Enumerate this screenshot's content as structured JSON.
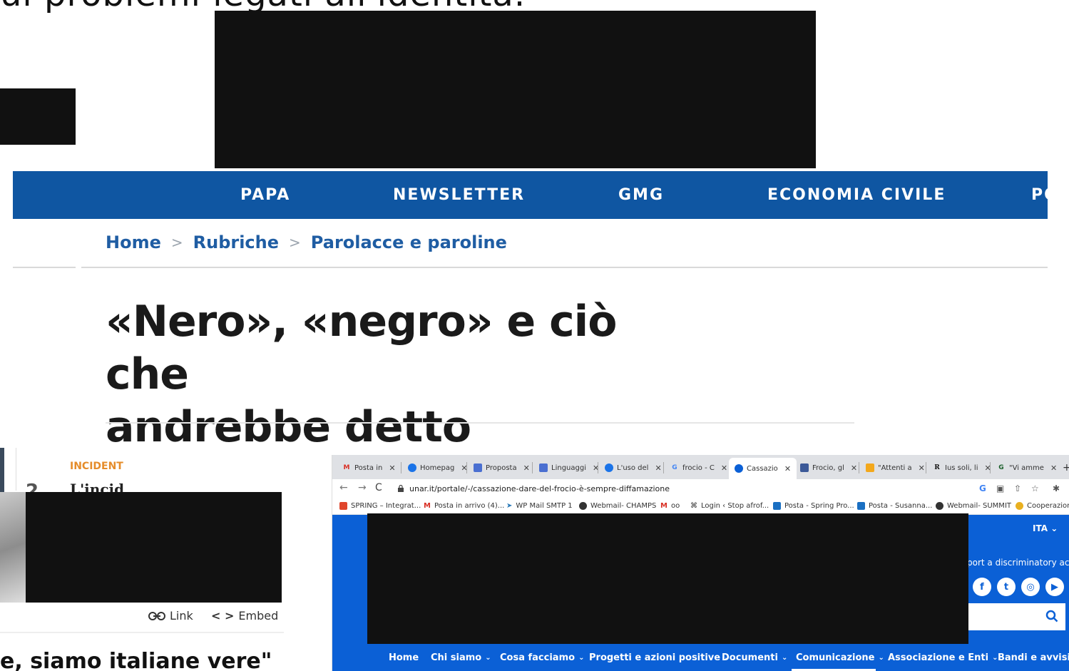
{
  "top_heading": "ui problemi legati all'identità.",
  "avvenire": {
    "nav": [
      "PAPA",
      "NEWSLETTER",
      "GMG",
      "ECONOMIA CIVILE",
      "PO"
    ],
    "breadcrumb": [
      "Home",
      "Rubriche",
      "Parolacce e paroline"
    ],
    "breadcrumb_sep": ">",
    "title_line1": "«Nero», «negro» e ciò che",
    "title_line2": "andrebbe detto",
    "accent": "#0f56a2"
  },
  "left_fragment": {
    "category": "INCIDENT",
    "headline_start": "L'incid",
    "number": "2",
    "link_label": "Link",
    "embed_label": "Embed",
    "quote": "e, siamo italiane vere\""
  },
  "browser": {
    "tabs": [
      {
        "icon": "gmail-icon",
        "label": "Posta in"
      },
      {
        "icon": "homepage-icon",
        "label": "Homepag"
      },
      {
        "icon": "proposta-icon",
        "label": "Proposta"
      },
      {
        "icon": "linguaggio-icon",
        "label": "Linguaggi"
      },
      {
        "icon": "uso-icon",
        "label": "L'uso del"
      },
      {
        "icon": "google-icon",
        "label": "frocio - C"
      },
      {
        "icon": "cassazione-icon",
        "label": "Cassazio"
      },
      {
        "icon": "frocio-icon",
        "label": "Frocio, gl"
      },
      {
        "icon": "attenti-icon",
        "label": "\"Attenti a"
      },
      {
        "icon": "r-icon",
        "label": "Ius soli, li"
      },
      {
        "icon": "g-icon",
        "label": "\"Vi amme"
      }
    ],
    "new_tab": "+",
    "url": "unar.it/portale/-/cassazione-dare-del-frocio-è-sempre-diffamazione",
    "bookmarks": [
      "SPRING – Integrat...",
      "Posta in arrivo (4)...",
      "WP Mail SMTP 1",
      "Webmail- CHAMPS",
      "oo",
      "Login ‹ Stop afrof...",
      "Posta - Spring Pro...",
      "Posta - Susanna...",
      "Webmail- SUMMIT",
      "Cooperazione"
    ],
    "language": "ITA",
    "report_text": "port a discriminatory act",
    "site_nav": [
      {
        "label": "Home",
        "dropdown": false
      },
      {
        "label": "Chi siamo",
        "dropdown": true
      },
      {
        "label": "Cosa facciamo",
        "dropdown": true
      },
      {
        "label": "Progetti e azioni positive",
        "dropdown": true
      },
      {
        "label": "Documenti",
        "dropdown": true
      },
      {
        "label": "Comunicazione",
        "dropdown": true
      },
      {
        "label": "Associazione e Enti",
        "dropdown": true
      },
      {
        "label": "Bandi e avvisi",
        "dropdown": true
      }
    ],
    "brand_color": "#0b60d6"
  }
}
